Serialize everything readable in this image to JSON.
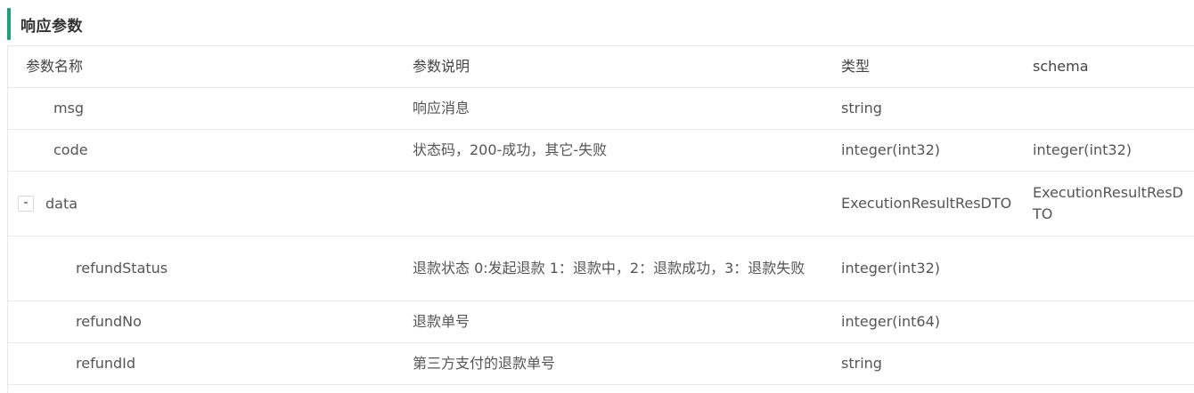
{
  "section": {
    "title": "响应参数"
  },
  "table": {
    "headers": {
      "name": "参数名称",
      "description": "参数说明",
      "type": "类型",
      "schema": "schema"
    },
    "rows": [
      {
        "name": "msg",
        "description": "响应消息",
        "type": "string",
        "schema": ""
      },
      {
        "name": "code",
        "description": "状态码，200-成功，其它-失败",
        "type": "integer(int32)",
        "schema": "integer(int32)"
      },
      {
        "name": "data",
        "toggle": "-",
        "description": "",
        "type": "ExecutionResultResDTO",
        "schema": "ExecutionResultResDTO"
      },
      {
        "name": "refundStatus",
        "description": "退款状态 0:发起退款 1：退款中，2：退款成功，3：退款失败",
        "type": "integer(int32)",
        "schema": ""
      },
      {
        "name": "refundNo",
        "description": "退款单号",
        "type": "integer(int64)",
        "schema": ""
      },
      {
        "name": "refundId",
        "description": "第三方支付的退款单号",
        "type": "string",
        "schema": ""
      }
    ]
  },
  "colors": {
    "accent": "#1aa37a",
    "border": "#e8e8e8",
    "text": "#555555"
  }
}
